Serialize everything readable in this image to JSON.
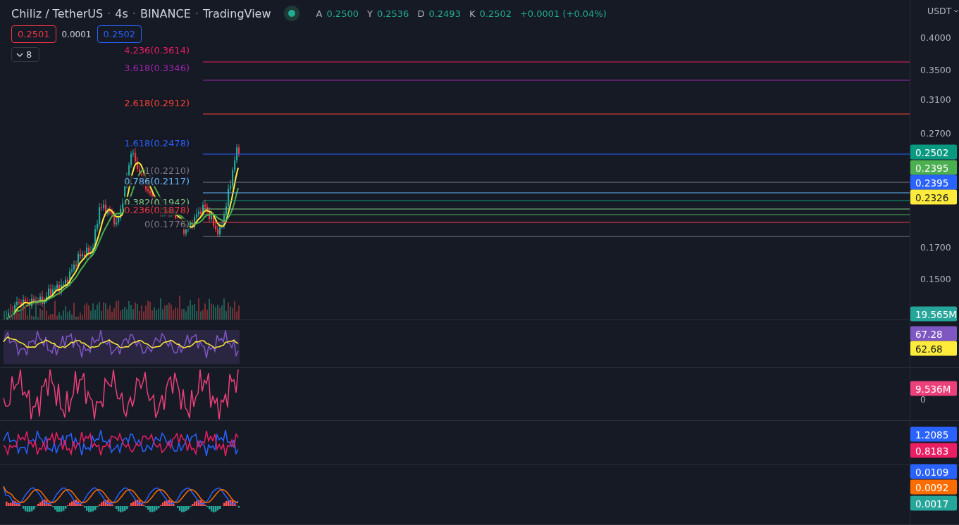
{
  "header": {
    "separator": "·",
    "title_parts": [
      "Chiliz / TetherUS",
      "4s",
      "BINANCE",
      "TradingView"
    ],
    "ohlc": [
      {
        "label": "A",
        "value": "0.2500"
      },
      {
        "label": "Y",
        "value": "0.2536"
      },
      {
        "label": "D",
        "value": "0.2493"
      },
      {
        "label": "K",
        "value": "0.2502"
      }
    ],
    "change": "+0.0001 (+0.04%)"
  },
  "trade": {
    "sell": "0.2501",
    "spread": "0.0001",
    "buy": "0.2502"
  },
  "indicators_toggle": {
    "count": "8"
  },
  "fib_levels": [
    {
      "label": "4.236(0.3614)",
      "color": "#e91e63"
    },
    {
      "label": "3.618(0.3346)",
      "color": "#9c27b0"
    },
    {
      "label": "2.618(0.2912)",
      "color": "#f44336"
    },
    {
      "label": "1.618(0.2478)",
      "color": "#2962ff"
    },
    {
      "label": "1(0.2210)",
      "color": "#787b86"
    },
    {
      "label": "0.786(0.2117)",
      "color": "#64b5f6"
    },
    {
      "label": "0.382(0.1942)",
      "color": "#81c784"
    },
    {
      "label": "0.236(0.1878)",
      "color": "#f23645"
    },
    {
      "label": "0(0.1776)",
      "color": "#787b86"
    }
  ],
  "price_axis": {
    "currency": "USDT",
    "ticks": [
      "0.4000",
      "0.3500",
      "0.3100",
      "0.2700",
      "0.1700",
      "0.1500"
    ],
    "badges": [
      {
        "value": "0.2502",
        "color": "#089981"
      },
      {
        "value": "0.2395",
        "color": "#4caf50"
      },
      {
        "value": "0.2395",
        "color": "#2962ff"
      },
      {
        "value": "0.2326",
        "color": "#ffeb3b"
      },
      {
        "value": "19.565M",
        "color": "#26a69a"
      }
    ]
  },
  "panes": [
    {
      "kind": "rsi",
      "badges": [
        {
          "value": "67.28",
          "color": "#7e57c2"
        },
        {
          "value": "62.68",
          "color": "#ffeb3b"
        }
      ]
    },
    {
      "kind": "osc",
      "ticks": [
        "0"
      ],
      "badges": [
        {
          "value": "9.536M",
          "color": "#ec407a"
        }
      ]
    },
    {
      "kind": "dmi",
      "badges": [
        {
          "value": "1.2085",
          "color": "#2962ff"
        },
        {
          "value": "0.8183",
          "color": "#e91e63"
        }
      ]
    },
    {
      "kind": "macd",
      "badges": [
        {
          "value": "0.0109",
          "color": "#2962ff"
        },
        {
          "value": "0.0092",
          "color": "#ff6d00"
        },
        {
          "value": "0.0017",
          "color": "#26a69a"
        }
      ]
    }
  ]
}
